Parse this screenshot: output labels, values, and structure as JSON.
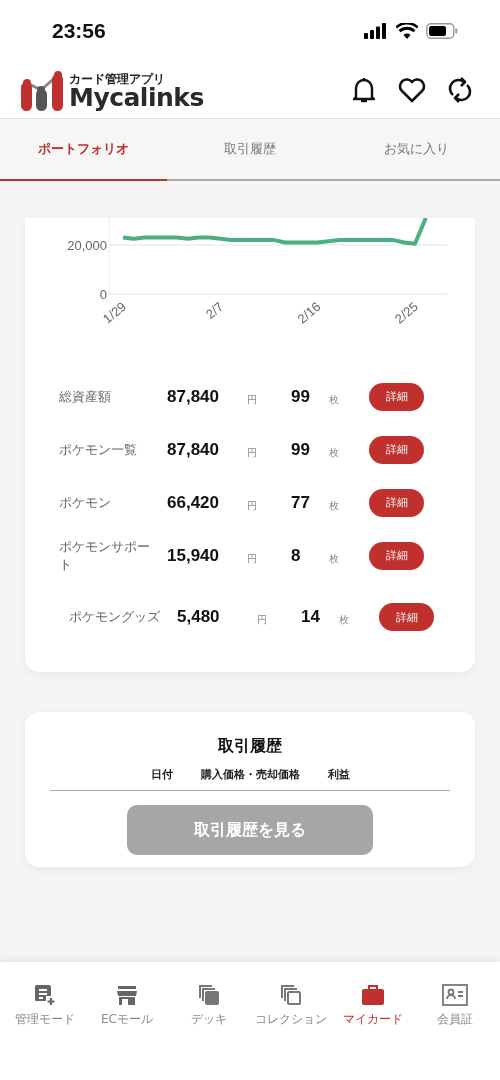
{
  "status_bar": {
    "time": "23:56"
  },
  "header": {
    "logo_caption": "カード管理アプリ",
    "logo_name": "Mycalinks"
  },
  "tabs": [
    {
      "label": "ポートフォリオ",
      "selected": true
    },
    {
      "label": "取引履歴",
      "selected": false
    },
    {
      "label": "お気に入り",
      "selected": false
    }
  ],
  "portfolio": {
    "chart_data": {
      "type": "line",
      "categories": [
        "1/29",
        null,
        null,
        null,
        null,
        null,
        null,
        null,
        null,
        "2/7",
        null,
        null,
        null,
        null,
        null,
        null,
        null,
        null,
        "2/16",
        null,
        null,
        null,
        null,
        null,
        null,
        null,
        null,
        "2/25",
        null
      ],
      "series": [
        {
          "color": "#4caf82",
          "values": [
            23000,
            22500,
            23000,
            23000,
            23000,
            23000,
            22500,
            23000,
            23000,
            22500,
            22000,
            22000,
            22000,
            22000,
            22000,
            21000,
            21000,
            21000,
            21000,
            21500,
            22000,
            22000,
            22000,
            22000,
            22000,
            22000,
            21000,
            20500,
            31000
          ]
        }
      ],
      "ylim": [
        0,
        31000
      ],
      "yticks": [
        {
          "value": 0,
          "label": "0"
        },
        {
          "value": 20000,
          "label": "20,000"
        }
      ]
    },
    "rows": [
      {
        "label": "総資産額",
        "amount": "87,840",
        "yen": "円",
        "count": "99",
        "unit": "枚",
        "button": "詳細"
      },
      {
        "label": "ポケモン一覧",
        "amount": "87,840",
        "yen": "円",
        "count": "99",
        "unit": "枚",
        "button": "詳細"
      },
      {
        "label": "ポケモン",
        "amount": "66,420",
        "yen": "円",
        "count": "77",
        "unit": "枚",
        "button": "詳細"
      },
      {
        "label": "ポケモンサポート",
        "amount": "15,940",
        "yen": "円",
        "count": "8",
        "unit": "枚",
        "button": "詳細"
      },
      {
        "label": "ポケモングッズ",
        "amount": "5,480",
        "yen": "円",
        "count": "14",
        "unit": "枚",
        "button": "詳細"
      }
    ]
  },
  "history": {
    "title": "取引履歴",
    "columns": [
      "日付",
      "購入価格・売却価格",
      "利益"
    ],
    "button": {
      "label": "取引履歴を見る",
      "disabled": true
    }
  },
  "bottom_nav": [
    {
      "label": "管理モード",
      "selected": false
    },
    {
      "label": "ECモール",
      "selected": false
    },
    {
      "label": "デッキ",
      "selected": false
    },
    {
      "label": "コレクション",
      "selected": false
    },
    {
      "label": "マイカード",
      "selected": true
    },
    {
      "label": "会員証",
      "selected": false
    }
  ]
}
